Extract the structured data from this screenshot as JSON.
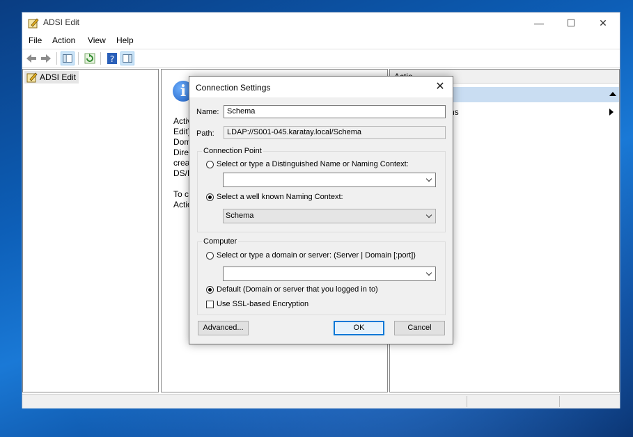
{
  "window": {
    "title": "ADSI Edit",
    "controls": {
      "minimize": "—",
      "maximize": "☐",
      "close": "✕"
    }
  },
  "menu": [
    "File",
    "Action",
    "View",
    "Help"
  ],
  "tree": {
    "root": "ADSI Edit"
  },
  "middle": {
    "lines": [
      "Activ",
      "Edit)",
      "Dom",
      "Direc",
      "creat",
      "DS/L",
      "To c",
      "Actio"
    ]
  },
  "actions": {
    "header": "Actio",
    "row_label": "ns"
  },
  "dialog": {
    "title": "Connection Settings",
    "close": "✕",
    "name_label": "Name:",
    "name_value": "Schema",
    "path_label": "Path:",
    "path_value": "LDAP://S001-045.karatay.local/Schema",
    "connection_point": {
      "legend": "Connection Point",
      "option_dn": "Select or type a Distinguished Name or Naming Context:",
      "dn_value": "",
      "option_wellknown": "Select a well known Naming Context:",
      "wellknown_value": "Schema",
      "selected": "wellknown"
    },
    "computer": {
      "legend": "Computer",
      "option_server": "Select or type a domain or server: (Server | Domain [:port])",
      "server_value": "",
      "option_default": "Default (Domain or server that you logged in to)",
      "selected": "default",
      "ssl_label": "Use SSL-based Encryption",
      "ssl_checked": false
    },
    "buttons": {
      "advanced": "Advanced...",
      "ok": "OK",
      "cancel": "Cancel"
    }
  }
}
